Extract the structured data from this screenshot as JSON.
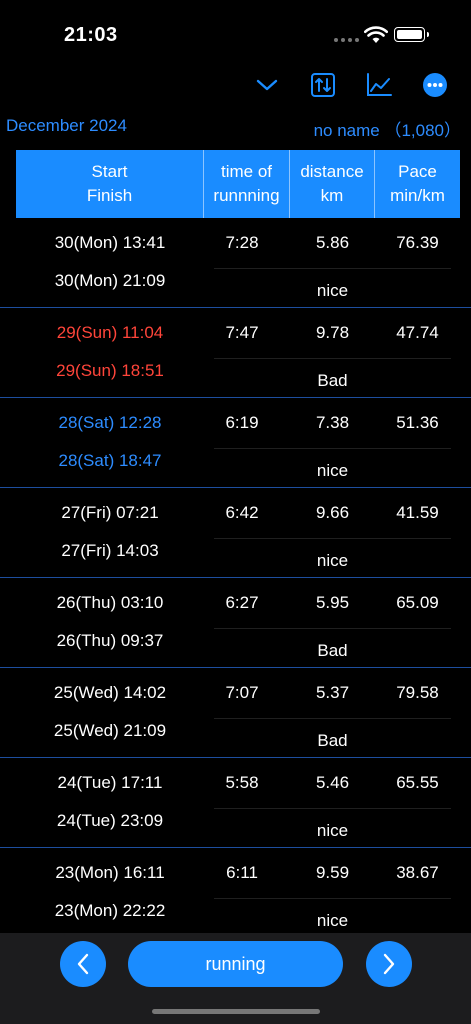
{
  "status": {
    "time": "21:03"
  },
  "toolbar": {
    "icons": [
      "chevron-down-icon",
      "sort-arrows-icon",
      "line-chart-icon",
      "more-icon"
    ],
    "accent": "#1a8cff"
  },
  "info": {
    "month": "December 2024",
    "user": "no name （1,080）"
  },
  "table": {
    "headers": [
      {
        "line1": "Start",
        "line2": "Finish"
      },
      {
        "line1": "time of",
        "line2": "runnning"
      },
      {
        "line1": "distance",
        "line2": "km"
      },
      {
        "line1": "Pace",
        "line2": "min/km"
      }
    ],
    "rows": [
      {
        "start": "30(Mon) 13:41",
        "finish": "30(Mon) 21:09",
        "time": "7:28",
        "distance": "5.86",
        "pace": "76.39",
        "rating": "nice",
        "color": "default"
      },
      {
        "start": "29(Sun) 11:04",
        "finish": "29(Sun) 18:51",
        "time": "7:47",
        "distance": "9.78",
        "pace": "47.74",
        "rating": "Bad",
        "color": "red"
      },
      {
        "start": "28(Sat) 12:28",
        "finish": "28(Sat) 18:47",
        "time": "6:19",
        "distance": "7.38",
        "pace": "51.36",
        "rating": "nice",
        "color": "blue"
      },
      {
        "start": "27(Fri) 07:21",
        "finish": "27(Fri) 14:03",
        "time": "6:42",
        "distance": "9.66",
        "pace": "41.59",
        "rating": "nice",
        "color": "default"
      },
      {
        "start": "26(Thu) 03:10",
        "finish": "26(Thu) 09:37",
        "time": "6:27",
        "distance": "5.95",
        "pace": "65.09",
        "rating": "Bad",
        "color": "default"
      },
      {
        "start": "25(Wed) 14:02",
        "finish": "25(Wed) 21:09",
        "time": "7:07",
        "distance": "5.37",
        "pace": "79.58",
        "rating": "Bad",
        "color": "default"
      },
      {
        "start": "24(Tue) 17:11",
        "finish": "24(Tue) 23:09",
        "time": "5:58",
        "distance": "5.46",
        "pace": "65.55",
        "rating": "nice",
        "color": "default"
      },
      {
        "start": "23(Mon) 16:11",
        "finish": "23(Mon) 22:22",
        "time": "6:11",
        "distance": "9.59",
        "pace": "38.67",
        "rating": "nice",
        "color": "default"
      }
    ]
  },
  "bottom": {
    "running_label": "running"
  }
}
